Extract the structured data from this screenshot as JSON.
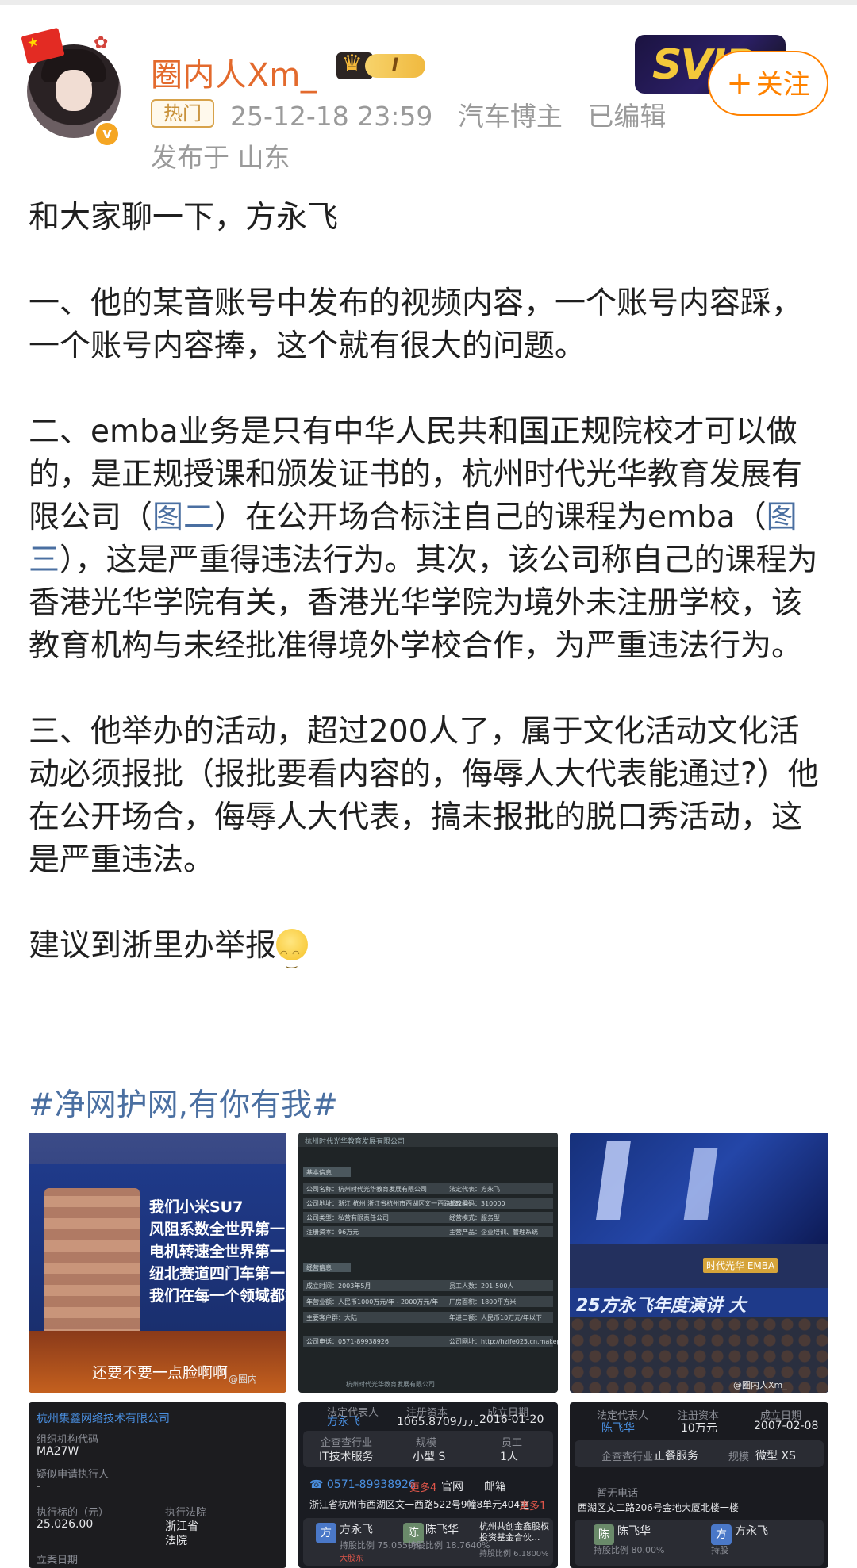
{
  "post": {
    "author": {
      "name": "圈内人Xm_",
      "vip_level": "I",
      "verified_icon": "v"
    },
    "hot_tag": "热门",
    "timestamp": "25-12-18 23:59",
    "author_tag": "汽车博主",
    "edited": "已编辑",
    "location": "发布于 山东",
    "follow_button": "关注",
    "svip_badge": "SVIP",
    "paragraphs": {
      "p1": "和大家聊一下，方永飞",
      "p2": "一、他的某音账号中发布的视频内容，一个账号内容踩，一个账号内容捧，这个就有很大的问题。",
      "p3_a": "二、emba业务是只有中华人民共和国正规院校才可以做的，是正规授课和颁发证书的，杭州时代光华教育发展有限公司（",
      "p3_link1": "图二",
      "p3_b": "）在公开场合标注自己的课程为emba（",
      "p3_link2": "图三",
      "p3_c": "），这是严重得违法行为。其次，该公司称自己的课程为香港光华学院有关，香港光华学院为境外未注册学校，该教育机构与未经批准得境外学校合作，为严重违法行为。",
      "p4": "三、他举办的活动，超过200人了，属于文化活动文化活动必须报批（报批要看内容的，侮辱人大代表能通过?）他在公开场合，侮辱人大代表，搞未报批的脱口秀活动，这是严重违法。",
      "p5": "建议到浙里办举报"
    },
    "hashtag": "#净网护网,有你有我#"
  },
  "images": {
    "img1": {
      "lines": [
        "我们小米SU7",
        "风阻系数全世界第一",
        "电机转速全世界第一",
        "纽北赛道四门车第一",
        "我们在每一个领域都第"
      ],
      "subtitle": "还要不要一点脸啊啊",
      "watermark": "@圈内"
    },
    "img2": {
      "header": "杭州时代光华教育发展有限公司",
      "section1": "基本信息",
      "section2": "经营信息",
      "cells": [
        "公司名称：杭州时代光华教育发展有限公司",
        "法定代表：方永飞",
        "公司地址：浙江 杭州 浙江省杭州市西湖区文一西路522号",
        "邮政编码：310000",
        "公司类型：私营有限责任公司",
        "经营模式：服务型",
        "注册资本：96万元",
        "主营产品：企业培训、管理系统",
        "成立时间：2003年5月",
        "员工人数：201-500人",
        "年营业额：人民币1000万元/年 - 2000万元/年",
        "厂房面积：1800平方米",
        "主要客户群：大陆",
        "年进口额：人民币10万元/年以下",
        "公司电话：0571-89938926",
        "公司网址：http://hzlfe025.cn.makepolo.com/"
      ],
      "footer": "杭州时代光华教育发展有限公司"
    },
    "img3": {
      "banner": "25方永飞年度演讲 大",
      "emba": "时代光华 EMBA",
      "watermark": "@圈内人Xm_"
    },
    "img4": {
      "company": "杭州集鑫网络技术有限公司",
      "org_code_label": "组织机构代码",
      "org_code": "MA27W",
      "dishonest_label": "疑似申请执行人",
      "dishonest_value": "-",
      "exec_amount_label": "执行标的（元）",
      "exec_amount": "25,026.00",
      "exec_court_label": "执行法院",
      "exec_court": "浙江省",
      "exec_court_2": "法院",
      "date_label": "立案日期"
    },
    "img5": {
      "legal_rep_label": "法定代表人",
      "legal_rep": "方永飞",
      "capital_label": "注册资本",
      "capital": "1065.8709万元",
      "founded_label": "成立日期",
      "founded": "2016-01-20",
      "industry_label": "企查查行业",
      "industry": "IT技术服务",
      "scale_label": "规模",
      "scale": "小型 S",
      "staff_label": "员工",
      "staff": "1人",
      "phone": "0571-89938926",
      "phone_more": "更多4",
      "site": "官网",
      "mail": "邮箱",
      "address": "浙江省杭州市西湖区文一西路522号9幢8单元404室",
      "address_more": "更多1",
      "holders": [
        {
          "name": "方永飞",
          "share": "持股比例 75.0550%",
          "tag": "大股东"
        },
        {
          "name": "陈飞华",
          "share": "持股比例 18.7640%",
          "tag": ""
        },
        {
          "name": "杭州共创金鑫股权投资基金合伙...",
          "share": "持股比例 6.1800%",
          "tag": ""
        }
      ]
    },
    "img6": {
      "legal_rep_label": "法定代表人",
      "legal_rep": "陈飞华",
      "capital_label": "注册资本",
      "capital": "10万元",
      "founded_label": "成立日期",
      "founded": "2007-02-08",
      "industry_label": "企查查行业",
      "industry": "正餐服务",
      "scale_label": "规模",
      "scale": "微型 XS",
      "phone_label": "暂无电话",
      "address": "西湖区文二路206号金地大厦北楼一楼",
      "holders": [
        {
          "name": "陈飞华",
          "share": "持股比例 80.00%"
        },
        {
          "name": "方永飞",
          "share": "持股"
        }
      ]
    }
  }
}
